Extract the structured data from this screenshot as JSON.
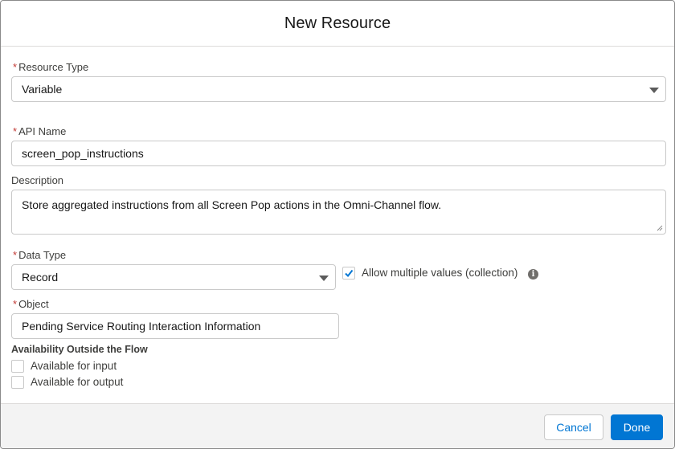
{
  "modal": {
    "title": "New Resource"
  },
  "form": {
    "resource_type": {
      "label": "Resource Type",
      "required": "*",
      "value": "Variable"
    },
    "api_name": {
      "label": "API Name",
      "required": "*",
      "value": "screen_pop_instructions"
    },
    "description": {
      "label": "Description",
      "value": "Store aggregated instructions from all Screen Pop actions in the Omni-Channel flow."
    },
    "data_type": {
      "label": "Data Type",
      "required": "*",
      "value": "Record"
    },
    "allow_multiple": {
      "label": "Allow multiple values (collection)",
      "checked": true,
      "info_icon": "info-icon"
    },
    "object": {
      "label": "Object",
      "required": "*",
      "value": "Pending Service Routing Interaction Information"
    },
    "availability": {
      "title": "Availability Outside the Flow",
      "input_label": "Available for input",
      "input_checked": false,
      "output_label": "Available for output",
      "output_checked": false
    }
  },
  "footer": {
    "cancel_label": "Cancel",
    "done_label": "Done"
  },
  "colors": {
    "brand": "#0176d3",
    "required": "#c23934",
    "footer_bg": "#f3f3f3"
  }
}
